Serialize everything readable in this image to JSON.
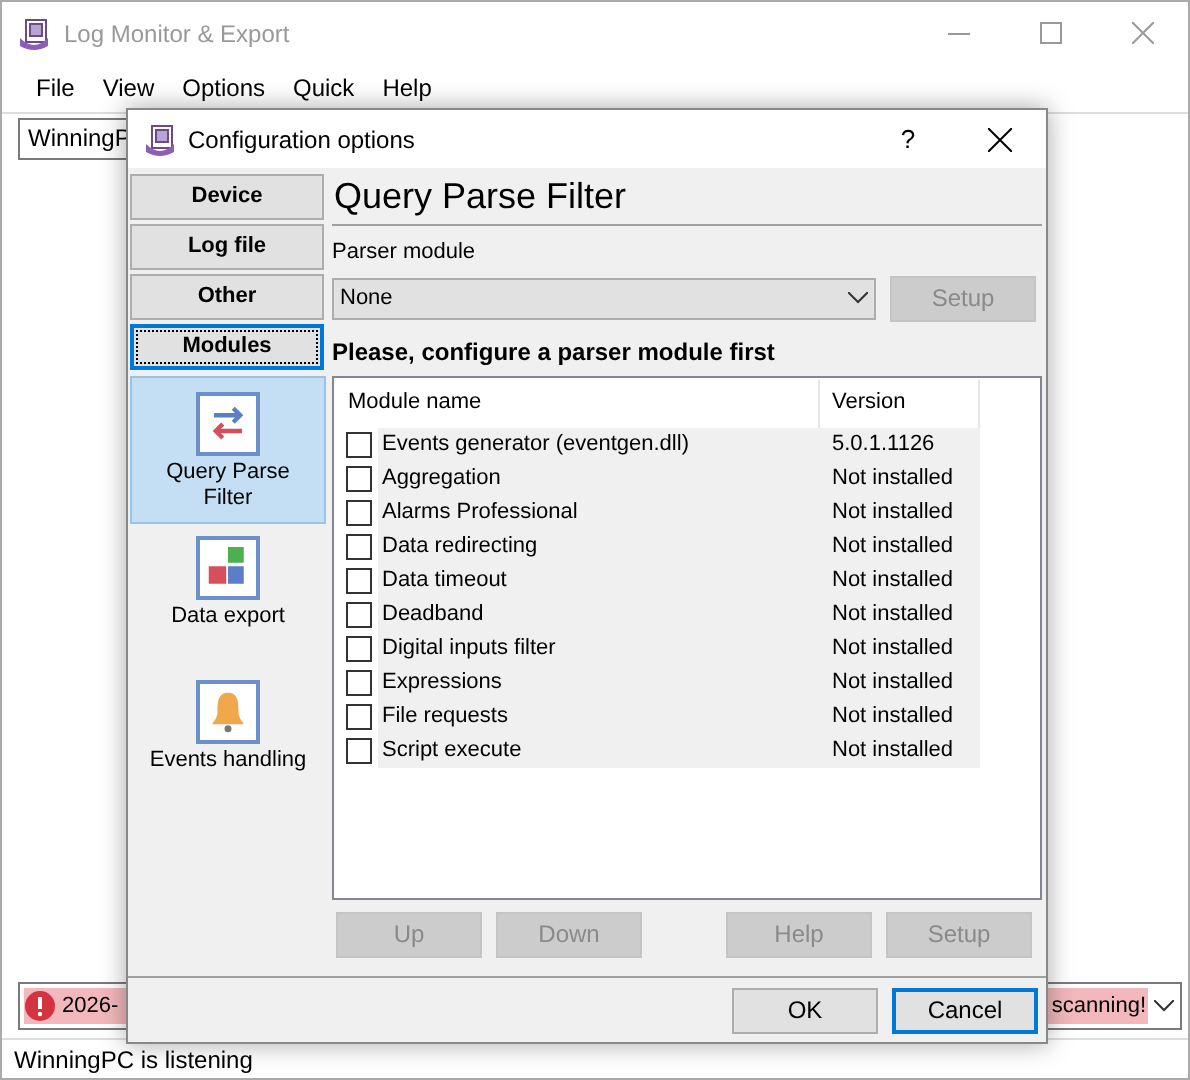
{
  "window": {
    "title": "Log Monitor & Export"
  },
  "menu": [
    "File",
    "View",
    "Options",
    "Quick",
    "Help"
  ],
  "toolbar": {
    "computer_field": "WinningP"
  },
  "message_bar": {
    "start": "2026-",
    "end": "scanning!"
  },
  "status_bar": "WinningPC is listening",
  "dialog": {
    "title": "Configuration options",
    "help": "?",
    "tabs": [
      {
        "label": "Device",
        "selected": false
      },
      {
        "label": "Log file",
        "selected": false
      },
      {
        "label": "Other",
        "selected": false
      },
      {
        "label": "Modules",
        "selected": true
      }
    ],
    "modules": [
      {
        "kind": "filter",
        "label": "Query Parse Filter",
        "selected": true
      },
      {
        "kind": "export",
        "label": "Data export",
        "selected": false
      },
      {
        "kind": "events",
        "label": "Events handling",
        "selected": false
      }
    ],
    "heading": "Query Parse Filter",
    "parser_label": "Parser module",
    "parser_value": "None",
    "parser_setup": {
      "label": "Setup",
      "disabled": true
    },
    "notice": "Please, configure a parser module first",
    "columns": [
      "Module name",
      "Version"
    ],
    "rows": [
      {
        "name": "Events generator (eventgen.dll)",
        "version": "5.0.1.1126",
        "checked": false
      },
      {
        "name": "Aggregation",
        "version": "Not installed",
        "checked": false
      },
      {
        "name": "Alarms Professional",
        "version": "Not installed",
        "checked": false
      },
      {
        "name": "Data redirecting",
        "version": "Not installed",
        "checked": false
      },
      {
        "name": "Data timeout",
        "version": "Not installed",
        "checked": false
      },
      {
        "name": "Deadband",
        "version": "Not installed",
        "checked": false
      },
      {
        "name": "Digital inputs filter",
        "version": "Not installed",
        "checked": false
      },
      {
        "name": "Expressions",
        "version": "Not installed",
        "checked": false
      },
      {
        "name": "File requests",
        "version": "Not installed",
        "checked": false
      },
      {
        "name": "Script execute",
        "version": "Not installed",
        "checked": false
      }
    ],
    "list_buttons": [
      {
        "label": "Up",
        "disabled": true
      },
      {
        "label": "Down",
        "disabled": true
      },
      {
        "label": "Help",
        "disabled": true
      },
      {
        "label": "Setup",
        "disabled": true
      }
    ],
    "footer_buttons": [
      {
        "label": "OK",
        "selected": false
      },
      {
        "label": "Cancel",
        "selected": true
      }
    ]
  }
}
